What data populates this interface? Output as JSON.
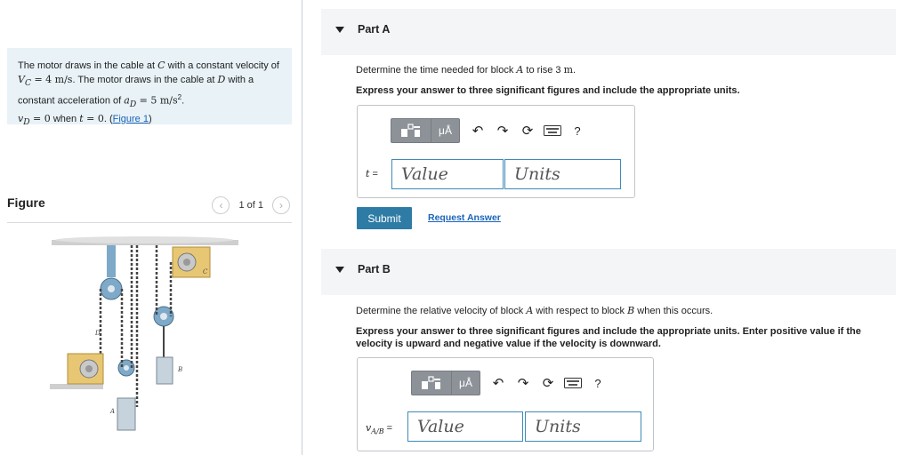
{
  "problem": {
    "t1": "The motor draws in the cable at ",
    "C": "C",
    "t2": " with a constant velocity of ",
    "vC": "V",
    "vC_sub": "C",
    "eq1": " = 4 m/s",
    "t3": ". The motor draws in the cable at ",
    "D": "D",
    "t4": " with a constant acceleration of ",
    "aD": "a",
    "aD_sub": "D",
    "eq2": " = 5 m/s",
    "sq": "2",
    "dot": ".",
    "vD": "v",
    "vD_sub": "D",
    "eq3": " = 0",
    "t5": " when ",
    "tvar": "t",
    "eq4": " = 0",
    "t6": ". (",
    "fig_link": "Figure 1",
    "t7": ")"
  },
  "figure": {
    "title": "Figure",
    "pager": "1 of 1",
    "prev_icon": "chevron-left-icon",
    "next_icon": "chevron-right-icon",
    "labels": {
      "D": "D",
      "C": "C",
      "B": "B",
      "A": "A"
    }
  },
  "partA": {
    "label": "Part A",
    "q1a": "Determine the time needed for block ",
    "q1var": "A",
    "q1b": " to rise 3 ",
    "q1unit": "m",
    "q1c": ".",
    "q2": "Express your answer to three significant figures and include the appropriate units.",
    "var": "t",
    "eq": " =",
    "value_placeholder": "Value",
    "units_placeholder": "Units",
    "mu": "μÅ",
    "help": "?"
  },
  "submit_label": "Submit",
  "request_label": "Request Answer",
  "partB": {
    "label": "Part B",
    "q1a": "Determine the relative velocity of block ",
    "q1var1": "A",
    "q1b": " with respect to block ",
    "q1var2": "B",
    "q1c": " when this occurs.",
    "q2": "Express your answer to three significant figures and include the appropriate units. Enter positive value if the velocity is upward and negative value if the velocity is downward.",
    "var": "v",
    "var_sub": "A/B",
    "eq": " =",
    "value_placeholder": "Value",
    "units_placeholder": "Units",
    "mu": "μÅ",
    "help": "?"
  },
  "colors": {
    "accent": "#2e7ca6",
    "link": "#1a64b8",
    "problem_bg": "#e8f2f7",
    "input_border": "#3f8ab8"
  }
}
